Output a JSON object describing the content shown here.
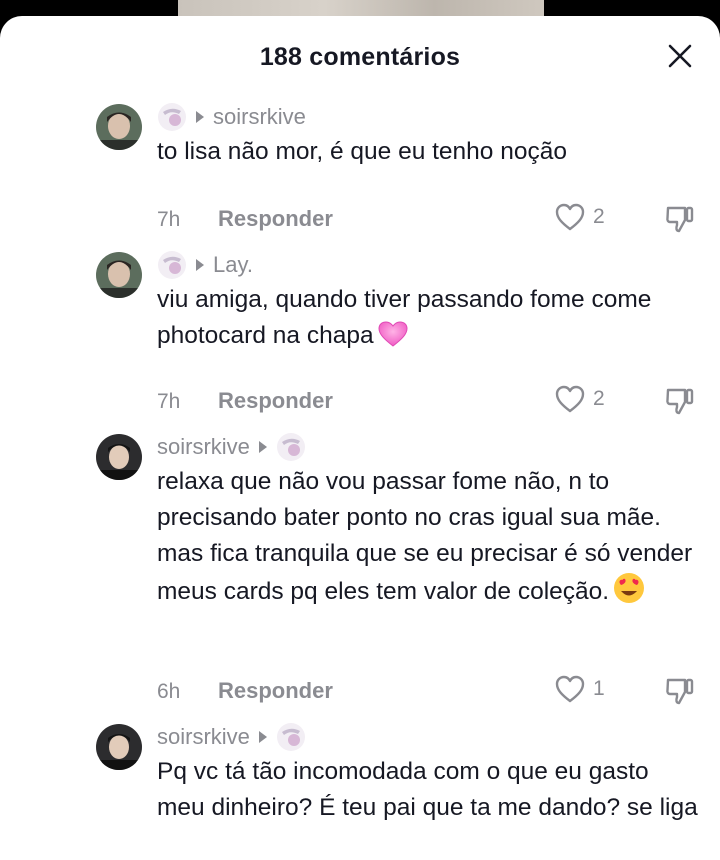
{
  "header": {
    "title": "188 comentários"
  },
  "comments": [
    {
      "author": "soirsrkive",
      "reply_to_author_first": false,
      "text": "to lisa não mor, é que eu tenho noção",
      "emoji": "",
      "time": "7h",
      "reply_label": "Responder",
      "likes": "2"
    },
    {
      "author": "Lay.",
      "reply_to_author_first": false,
      "text": "viu amiga, quando tiver passando fome come photocard na chapa",
      "emoji": "pink-heart",
      "time": "7h",
      "reply_label": "Responder",
      "likes": "2"
    },
    {
      "author": "soirsrkive",
      "reply_to_author_first": true,
      "text": "relaxa que não vou passar fome não, n to precisando bater ponto no cras igual sua mãe. mas fica tranquila que se eu precisar é só vender meus cards pq eles tem valor de coleção.",
      "emoji": "heart-eyes",
      "time": "6h",
      "reply_label": "Responder",
      "likes": "1"
    },
    {
      "author": "soirsrkive",
      "reply_to_author_first": true,
      "text": "Pq vc tá tão incomodada com o que eu gasto meu dinheiro? É teu pai que ta me dando? se liga",
      "emoji": "",
      "time": "",
      "reply_label": "",
      "likes": ""
    }
  ],
  "icons": {
    "close": "close-icon",
    "like": "heart-outline-icon",
    "dislike": "thumbs-down-icon"
  },
  "colors": {
    "text_primary": "#161823",
    "text_secondary": "#8a8b91",
    "sheet_background": "#ffffff"
  }
}
